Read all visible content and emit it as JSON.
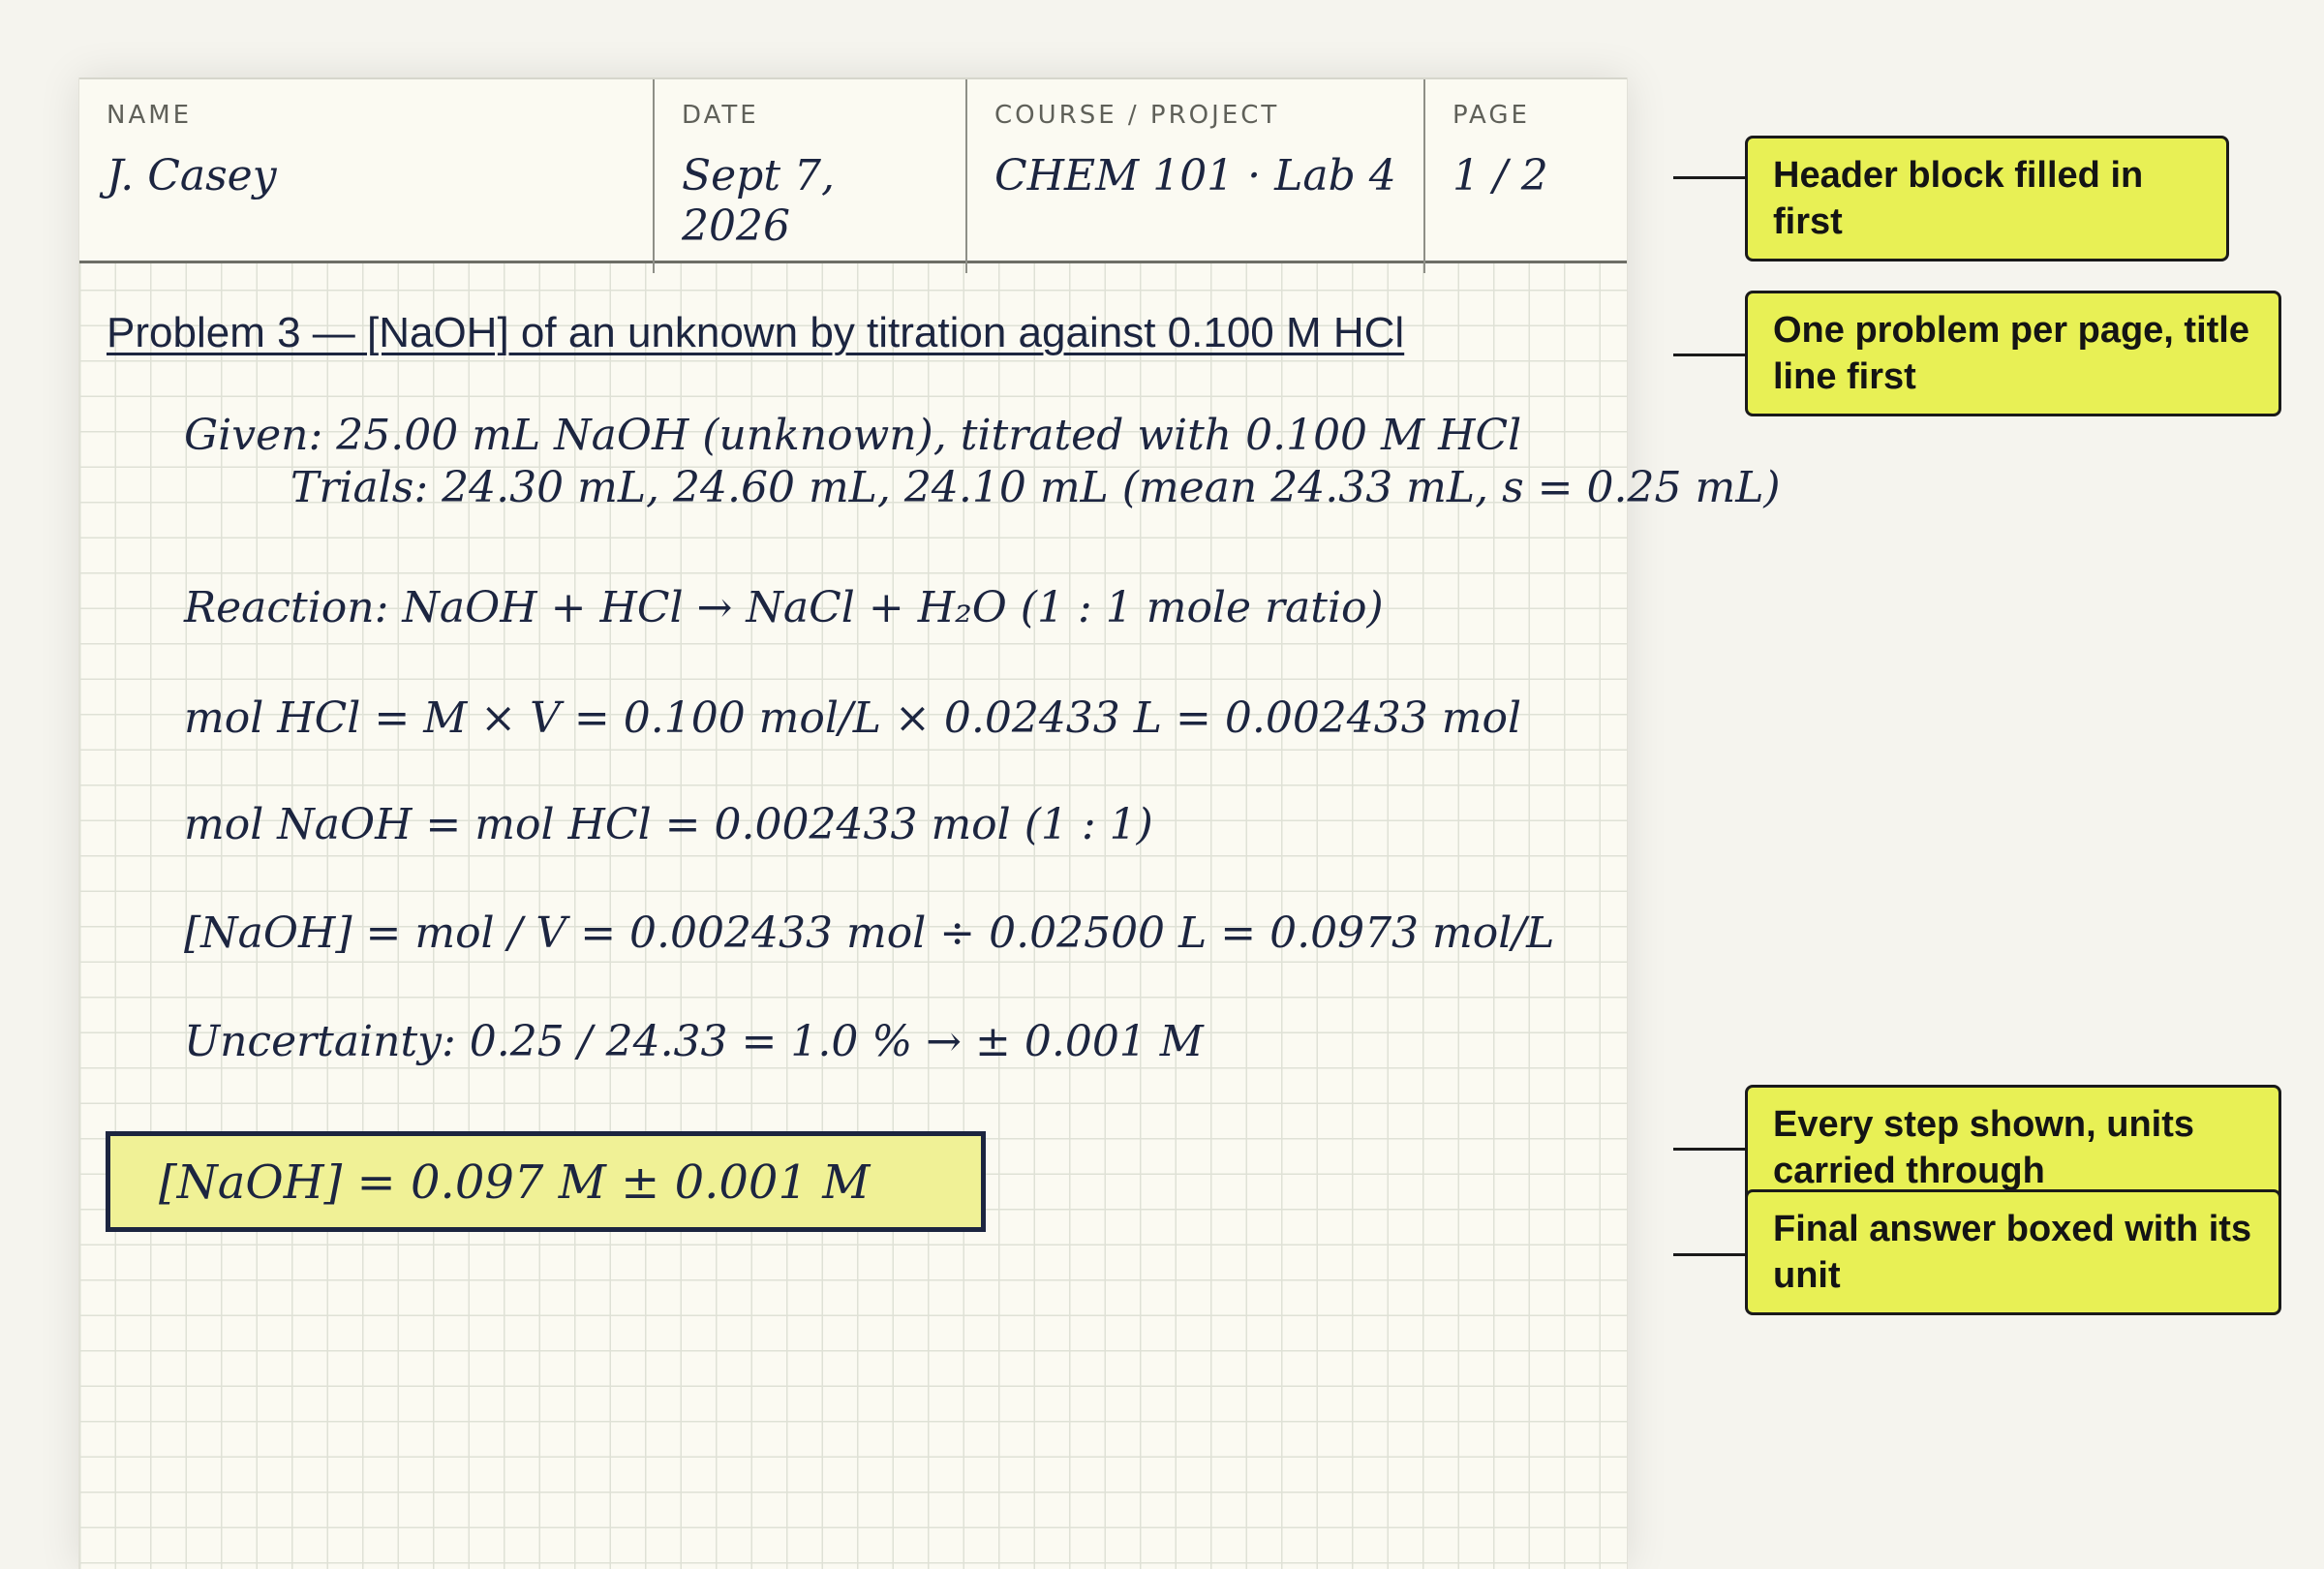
{
  "header": {
    "name_label": "NAME",
    "name_value": "J. Casey",
    "date_label": "DATE",
    "date_value": "Sept 7, 2026",
    "course_label": "COURSE / PROJECT",
    "course_value": "CHEM 101 · Lab 4",
    "page_label": "PAGE",
    "page_value": "1 / 2"
  },
  "problem": {
    "title": "Problem 3 — [NaOH] of an unknown by titration against 0.100 M HCl",
    "given": "Given:  25.00 mL NaOH (unknown), titrated with 0.100 M HCl",
    "trials": "Trials: 24.30 mL, 24.60 mL, 24.10 mL (mean 24.33 mL, s = 0.25 mL)",
    "reaction": "Reaction:  NaOH + HCl → NaCl + H₂O   (1 : 1 mole ratio)",
    "step_mol_hcl": "mol HCl = M × V = 0.100 mol/L × 0.02433 L = 0.002433 mol",
    "step_mol_naoh": "mol NaOH = mol HCl = 0.002433 mol   (1 : 1)",
    "step_conc": "[NaOH] = mol / V = 0.002433 mol ÷ 0.02500 L = 0.0973 mol/L",
    "step_uncert": "Uncertainty: 0.25 / 24.33 = 1.0 %  →  ± 0.001 M",
    "answer": "[NaOH] = 0.097 M ± 0.001 M"
  },
  "callouts": {
    "header": "Header block filled in first",
    "title": "One problem per page, title line first",
    "steps": "Every step shown, units carried through",
    "answer": "Final answer boxed with its unit"
  },
  "colors": {
    "ink": "#1c2540",
    "highlight": "#e8f055",
    "paper": "#fbfaf2"
  }
}
